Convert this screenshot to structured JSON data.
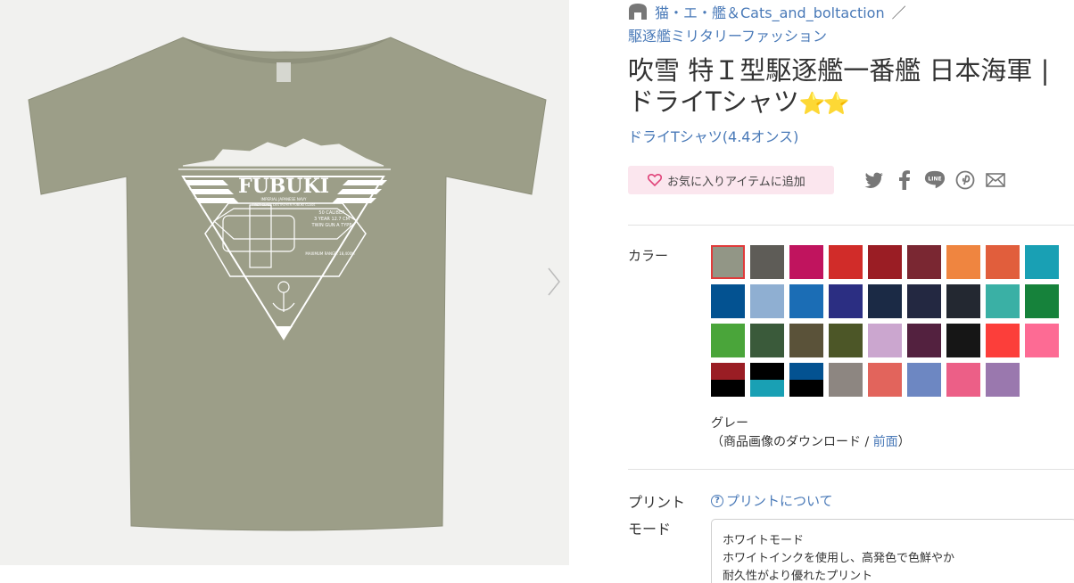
{
  "shop": {
    "name": "猫・エ・艦＆Cats_and_boltaction",
    "separator": "／",
    "category": "駆逐艦ミリタリーファッション"
  },
  "product": {
    "title": "吹雪 特Ｉ型駆逐艦一番艦 日本海軍 | ドライTシャツ",
    "stars": "⭐⭐",
    "type": "ドライTシャツ(4.4オンス)"
  },
  "favorite": {
    "label": "お気に入りアイテムに追加"
  },
  "share_icons": [
    "twitter-icon",
    "facebook-icon",
    "line-icon",
    "pinterest-icon",
    "mail-icon"
  ],
  "color": {
    "label": "カラー",
    "selected_name": "グレー",
    "download_prefix": "（商品画像のダウンロード / ",
    "download_link": "前面",
    "download_suffix": "）",
    "swatches": [
      "#929686",
      "#5e5c57",
      "#c0145e",
      "#d12c29",
      "#9a1d24",
      "#7a2732",
      "#ef8540",
      "#e15e3c",
      "#19a0b4",
      "#035291",
      "#8fafd2",
      "#1b6db5",
      "#2b2e82",
      "#1b2a45",
      "#232841",
      "#232831",
      "#3ab0a5",
      "#16823b",
      "#4aa53a",
      "#3a5a3a",
      "#5a5239",
      "#4c5627",
      "#cba6cf",
      "#53213f",
      "#161616",
      "#fc3e3a",
      "#fd6b94",
      "split:#9a1d24/#000000",
      "split:#000000/#19a0b4",
      "split:#035291/#000000",
      "#8d8681",
      "#e2645c",
      "#6d87c2",
      "#ec5f87",
      "#9a78ae"
    ]
  },
  "print": {
    "label_line1": "プリント",
    "label_line2": "モード",
    "about_link": "プリントについて",
    "mode_title": "ホワイトモード",
    "mode_desc1": "ホワイトインクを使用し、高発色で色鮮やか",
    "mode_desc2": "耐久性がより優れたプリント"
  },
  "design": {
    "main_text": "FUBUKI",
    "line1": "IMPERIAL JAPANESE NAVY",
    "line2": "FIRST CLASS DESTROYER FUBUKI CLASS",
    "line3": "50 CALIBER",
    "line4": "3 YEAR 12.7 CM",
    "line5": "TWIN GUN A TYPE",
    "line6": "MAXIMUM RANGE: 18,400M",
    "shirt_color": "#9c9e88"
  }
}
